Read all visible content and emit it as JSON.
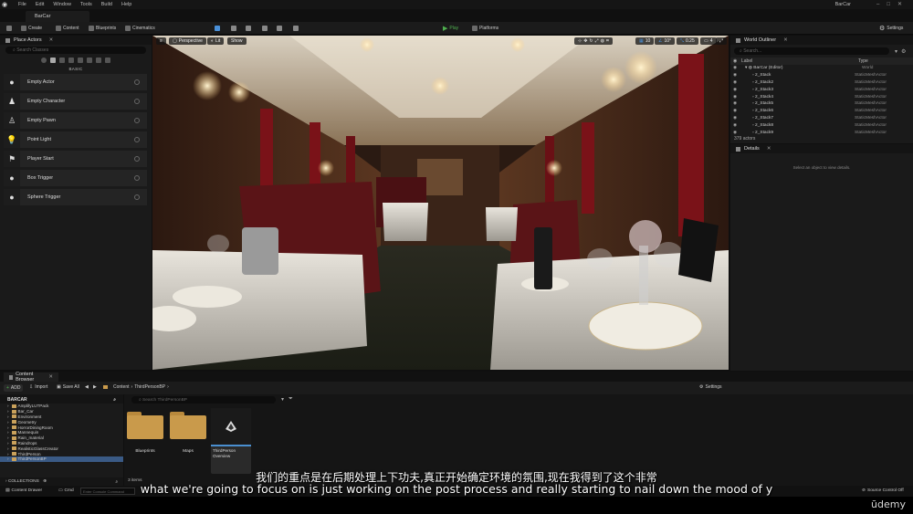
{
  "menubar": {
    "items": [
      "File",
      "Edit",
      "Window",
      "Tools",
      "Build",
      "Help"
    ],
    "project_title": "BarCar"
  },
  "tabs": {
    "level": "BarCar"
  },
  "toolbar": {
    "create": "Create",
    "content": "Content",
    "blueprints": "Blueprints",
    "cinematics": "Cinematics",
    "play": "Play",
    "platforms": "Platforms",
    "settings": "Settings"
  },
  "place_actors": {
    "title": "Place Actors",
    "search_placeholder": "Search Classes",
    "section": "BASIC",
    "items": [
      {
        "label": "Empty Actor",
        "icon": "actor-sphere-icon"
      },
      {
        "label": "Empty Character",
        "icon": "character-icon"
      },
      {
        "label": "Empty Pawn",
        "icon": "pawn-icon"
      },
      {
        "label": "Point Light",
        "icon": "light-bulb-icon"
      },
      {
        "label": "Player Start",
        "icon": "player-start-icon"
      },
      {
        "label": "Box Trigger",
        "icon": "box-trigger-icon"
      },
      {
        "label": "Sphere Trigger",
        "icon": "sphere-trigger-icon"
      }
    ]
  },
  "viewport": {
    "perspective": "Perspective",
    "lit": "Lit",
    "show": "Show",
    "grid_snap": "10",
    "rot_snap": "10°",
    "scale_snap": "0.25",
    "camera_speed": "4"
  },
  "outliner": {
    "title": "World Outliner",
    "search_placeholder": "Search...",
    "col_label": "Label",
    "col_type": "Type",
    "rows": [
      {
        "name": "BarCar (Editor)",
        "type": "World"
      },
      {
        "name": "2_Stack",
        "type": "StaticMeshActor"
      },
      {
        "name": "2_Stack2",
        "type": "StaticMeshActor"
      },
      {
        "name": "2_Stack3",
        "type": "StaticMeshActor"
      },
      {
        "name": "2_Stack4",
        "type": "StaticMeshActor"
      },
      {
        "name": "2_Stack5",
        "type": "StaticMeshActor"
      },
      {
        "name": "2_Stack6",
        "type": "StaticMeshActor"
      },
      {
        "name": "2_Stack7",
        "type": "StaticMeshActor"
      },
      {
        "name": "2_Stack8",
        "type": "StaticMeshActor"
      },
      {
        "name": "2_Stack9",
        "type": "StaticMeshActor"
      }
    ],
    "count": "379 actors"
  },
  "details": {
    "title": "Details",
    "empty_message": "Select an object to view details."
  },
  "content_browser": {
    "tab_title": "Content Browser",
    "add": "ADD",
    "import": "Import",
    "save_all": "Save All",
    "path_root": "Content",
    "path_leaf": "ThirdPersonBP",
    "settings": "Settings",
    "tree_header": "BARCAR",
    "folders": [
      "AmplifyLUTPack",
      "Bar_Car",
      "Environment",
      "Geometry",
      "HorrorDiningRoom",
      "Mannequin",
      "Rain_material",
      "Raindrops",
      "RealisticGlassCreator",
      "ThirdPerson",
      "ThirdPersonBP"
    ],
    "selected_folder": "ThirdPersonBP",
    "collections": "COLLECTIONS",
    "search_placeholder": "Search ThirdPersonBP",
    "assets": [
      {
        "label": "Blueprints",
        "kind": "folder"
      },
      {
        "label": "Maps",
        "kind": "folder"
      },
      {
        "label": "ThirdPerson Overview",
        "kind": "map"
      }
    ],
    "items_count": "3 items"
  },
  "statusbar": {
    "content_drawer": "Content Drawer",
    "cmd": "Cmd",
    "console_placeholder": "Enter Console Command",
    "source_control": "Source Control Off"
  },
  "subtitles": {
    "chinese": "我们的重点是在后期处理上下功夫,真正开始确定环境的氛围,现在我得到了这个非常",
    "english": "what we're going to focus on is just working on the post process and really starting to nail down the mood of y"
  },
  "watermark": "ūdemy",
  "colors": {
    "accent_play": "#4fb04f",
    "selection": "#3a5a85",
    "folder": "#c99a4b"
  }
}
